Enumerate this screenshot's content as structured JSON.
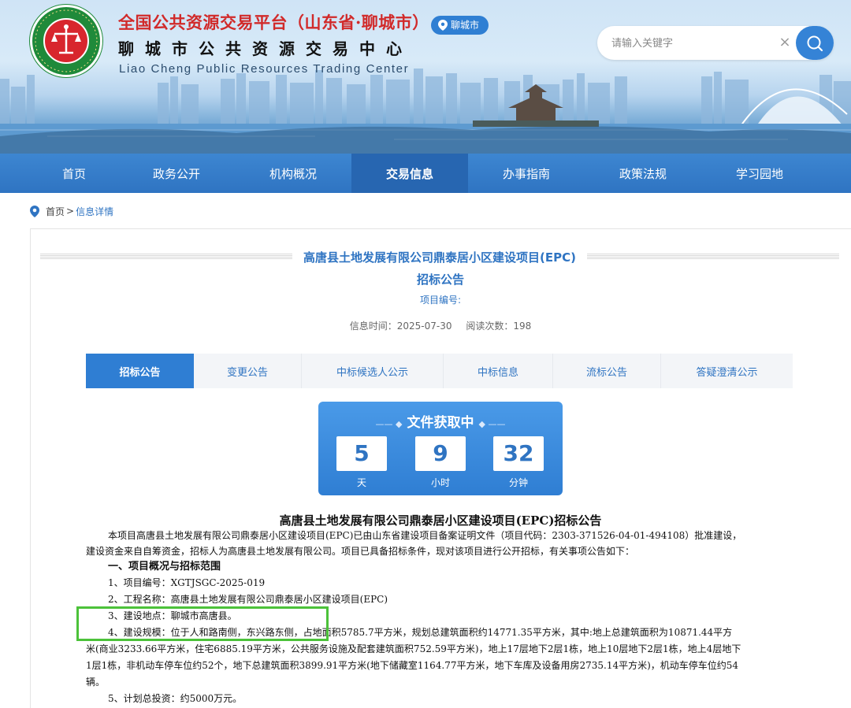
{
  "header": {
    "title_cn": "全国公共资源交易平台（山东省·聊城市）",
    "title_center": "聊城市公共资源交易中心",
    "title_en": "Liao Cheng Public Resources Trading Center",
    "city_badge": "聊城市",
    "search_placeholder": "请输入关键字",
    "clear_symbol": "×"
  },
  "nav": {
    "items": [
      "首页",
      "政务公开",
      "机构概况",
      "交易信息",
      "办事指南",
      "政策法规",
      "学习园地"
    ],
    "active_index": 3
  },
  "breadcrumb": {
    "home": "首页",
    "separator": ">",
    "current": "信息详情"
  },
  "article": {
    "title": "高唐县土地发展有限公司鼎泰居小区建设项目(EPC)",
    "subtitle": "招标公告",
    "project_code": "项目编号:",
    "info_time": "信息时间：2025-07-30",
    "read_count": "阅读次数：198"
  },
  "tabs": [
    "招标公告",
    "变更公告",
    "中标候选人公示",
    "中标信息",
    "流标公告",
    "答疑澄清公示"
  ],
  "countdown": {
    "title": "文件获取中",
    "deco_left": "—— ◆",
    "deco_right": "◆ ——",
    "days": "5",
    "days_unit": "天",
    "hours": "9",
    "hours_unit": "小时",
    "minutes": "32",
    "minutes_unit": "分钟"
  },
  "doc": {
    "title": "高唐县土地发展有限公司鼎泰居小区建设项目(EPC)招标公告",
    "lines": [
      "本项目高唐县土地发展有限公司鼎泰居小区建设项目(EPC)已由山东省建设项目备案证明文件（项目代码：2303-371526-04-01-494108）批准建设，",
      "建设资金来自自筹资金，招标人为高唐县土地发展有限公司。项目已具备招标条件，现对该项目进行公开招标，有关事项公告如下：",
      "一、项目概况与招标范围",
      "1、项目编号：XGTJSGC-2025-019",
      "2、工程名称：高唐县土地发展有限公司鼎泰居小区建设项目(EPC)",
      "3、建设地点：聊城市高唐县。",
      "4、建设规模：位于人和路南侧，东兴路东侧，占地面积5785.7平方米，规划总建筑面积约14771.35平方米，其中:地上总建筑面积为10871.44平方",
      "米(商业3233.66平方米，住宅6885.19平方米，公共服务设施及配套建筑面积752.59平方米)，地上17层地下2层1栋，地上10层地下2层1栋，地上4层地下",
      "1层1栋，非机动车停车位约52个，地下总建筑面积3899.91平方米(地下储藏室1164.77平方米，地下车库及设备用房2735.14平方米)，机动车停车位约54",
      "辆。",
      "5、计划总投资：约5000万元。"
    ]
  },
  "colors": {
    "primary": "#2f74c2",
    "nav_active": "#2766b1",
    "highlight": "#4cc23a",
    "title_red": "#d12a2a"
  }
}
